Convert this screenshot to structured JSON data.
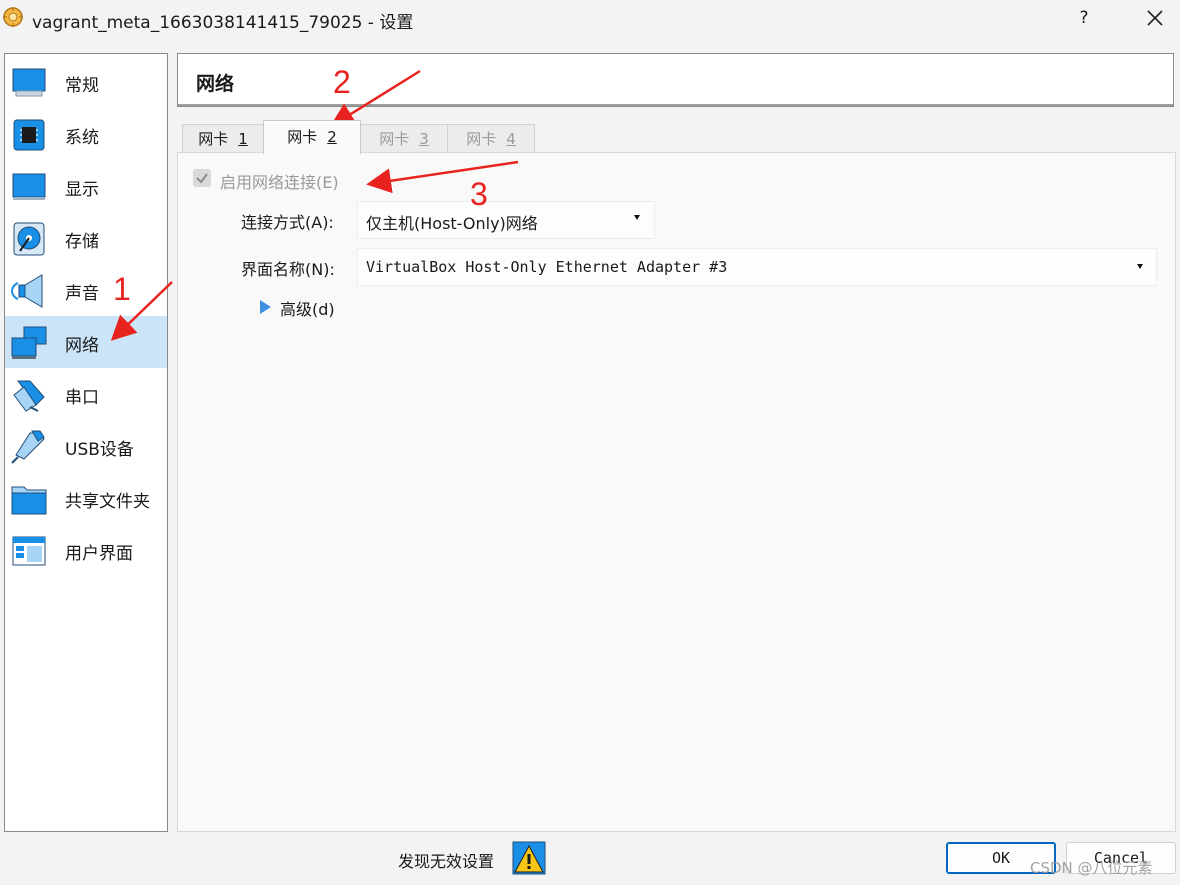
{
  "window": {
    "title": "vagrant_meta_1663038141415_79025 - 设置",
    "help": "?",
    "close_icon": "close-icon"
  },
  "sidebar": {
    "items": [
      {
        "label": "常规",
        "icon": "monitor-icon"
      },
      {
        "label": "系统",
        "icon": "chip-icon"
      },
      {
        "label": "显示",
        "icon": "display-icon"
      },
      {
        "label": "存储",
        "icon": "disk-icon"
      },
      {
        "label": "声音",
        "icon": "speaker-icon"
      },
      {
        "label": "网络",
        "icon": "network-icon",
        "selected": true
      },
      {
        "label": "串口",
        "icon": "serial-port-icon"
      },
      {
        "label": "USB设备",
        "icon": "usb-icon"
      },
      {
        "label": "共享文件夹",
        "icon": "folder-icon"
      },
      {
        "label": "用户界面",
        "icon": "window-ui-icon"
      }
    ]
  },
  "header": {
    "title": "网络"
  },
  "tabs": [
    {
      "prefix": "网卡",
      "num": "1",
      "state": "normal"
    },
    {
      "prefix": "网卡",
      "num": "2",
      "state": "active"
    },
    {
      "prefix": "网卡",
      "num": "3",
      "state": "disabled"
    },
    {
      "prefix": "网卡",
      "num": "4",
      "state": "disabled"
    }
  ],
  "adapter": {
    "enable_label": "启用网络连接(E)",
    "enable_checked": true,
    "attached_label": "连接方式(A):",
    "attached_value": "仅主机(Host-Only)网络",
    "name_label": "界面名称(N):",
    "name_value": "VirtualBox Host-Only Ethernet Adapter #3",
    "advanced_label": "高级(d)"
  },
  "footer": {
    "invalid_label": "发现无效设置",
    "ok": "OK",
    "cancel": "Cancel"
  },
  "annotations": [
    "1",
    "2",
    "3"
  ],
  "watermark": "CSDN @八位元素",
  "colors": {
    "accent": "#0067c0",
    "selection": "#cce4f7",
    "annotation": "#e8231f"
  }
}
